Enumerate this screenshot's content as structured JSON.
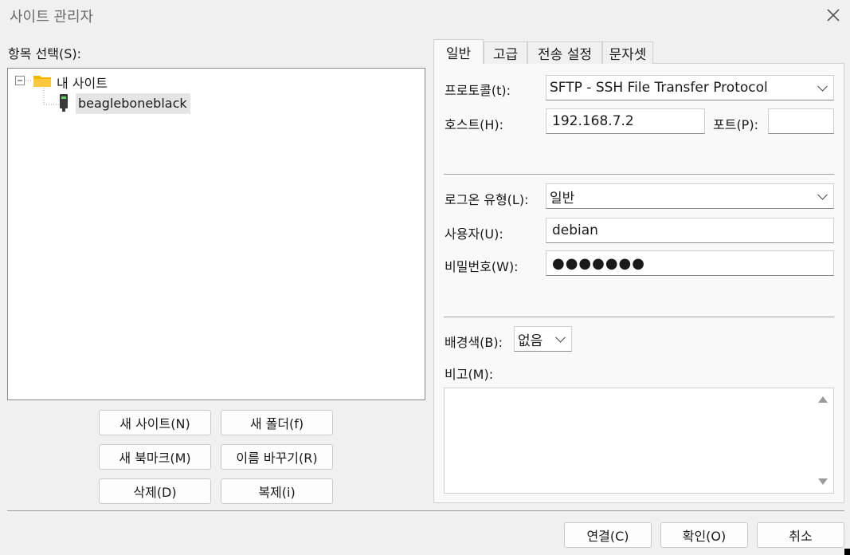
{
  "window": {
    "title": "사이트 관리자"
  },
  "left": {
    "heading": "항목 선택(S):",
    "tree": {
      "root_label": "내 사이트",
      "child_label": "beagleboneblack"
    },
    "buttons": {
      "new_site": "새 사이트(N)",
      "new_folder": "새 폴더(f)",
      "new_bookmark": "새 북마크(M)",
      "rename": "이름 바꾸기(R)",
      "delete": "삭제(D)",
      "duplicate": "복제(i)"
    }
  },
  "tabs": [
    "일반",
    "고급",
    "전송 설정",
    "문자셋"
  ],
  "general": {
    "protocol_label": "프로토콜(t):",
    "protocol_value": "SFTP - SSH File Transfer Protocol",
    "host_label": "호스트(H):",
    "host_value": "192.168.7.2",
    "port_label": "포트(P):",
    "port_value": "",
    "logon_label": "로그온 유형(L):",
    "logon_value": "일반",
    "user_label": "사용자(U):",
    "user_value": "debian",
    "password_label": "비밀번호(W):",
    "password_value": "●●●●●●●",
    "bg_label": "배경색(B):",
    "bg_value": "없음",
    "memo_label": "비고(M):"
  },
  "footer": {
    "connect": "연결(C)",
    "ok": "확인(O)",
    "cancel": "취소"
  },
  "colors": {
    "folder": "#f4b400",
    "selection": "#e5e5e5"
  }
}
